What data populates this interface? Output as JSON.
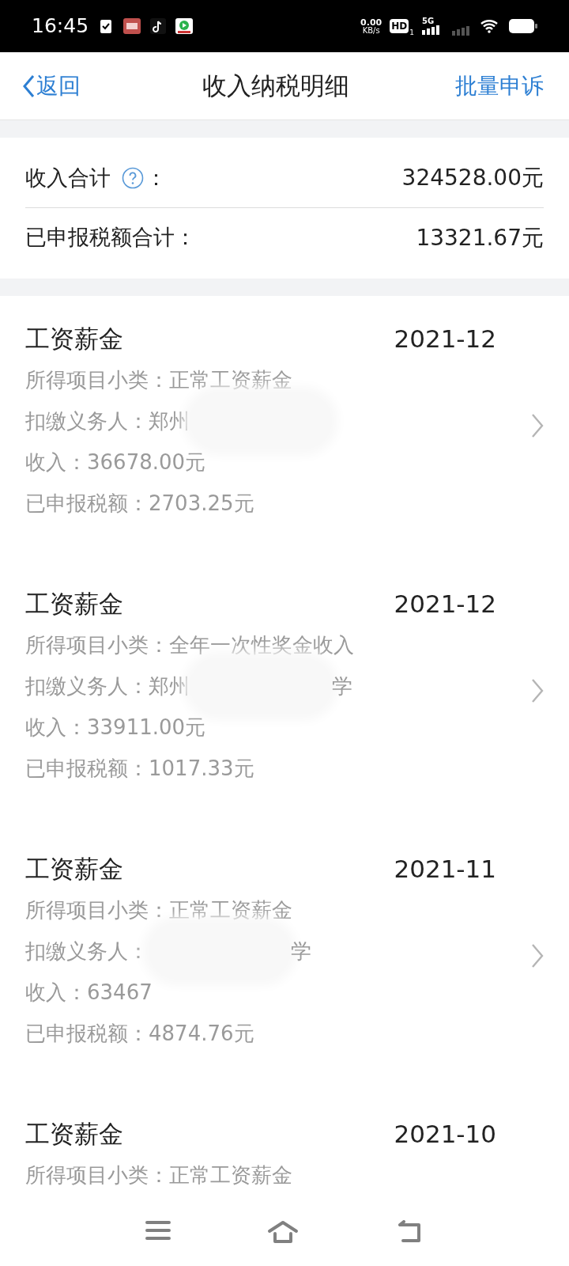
{
  "status_bar": {
    "time": "16:45",
    "net_speed": "0.00",
    "net_unit": "KB/s",
    "hd": "HD",
    "sim": "1",
    "network": "5G"
  },
  "nav": {
    "back": "返回",
    "title": "收入纳税明细",
    "action": "批量申诉"
  },
  "summary": [
    {
      "label": "收入合计",
      "help": true,
      "colon": "：",
      "value": "324528.00元"
    },
    {
      "label": "已申报税额合计：",
      "help": false,
      "value": "13321.67元"
    }
  ],
  "records": [
    {
      "title": "工资薪金",
      "date": "2021-12",
      "subtype": "所得项目小类：正常工资薪金",
      "payer_label": "扣缴义务人：",
      "payer_parts": [
        {
          "kind": "text",
          "text": "郑州"
        },
        {
          "kind": "redacted"
        }
      ],
      "income": "收入：36678.00元",
      "tax": "已申报税额：2703.25元"
    },
    {
      "title": "工资薪金",
      "date": "2021-12",
      "subtype": "所得项目小类：全年一次性奖金收入",
      "payer_label": "扣缴义务人：",
      "payer_parts": [
        {
          "kind": "text",
          "text": "郑州"
        },
        {
          "kind": "redacted"
        },
        {
          "kind": "text",
          "text": "学"
        }
      ],
      "income": "收入：33911.00元",
      "tax": "已申报税额：1017.33元"
    },
    {
      "title": "工资薪金",
      "date": "2021-11",
      "subtype": "所得项目小类：正常工资薪金",
      "payer_label": "扣缴义务人：",
      "payer_parts": [
        {
          "kind": "redacted"
        },
        {
          "kind": "text",
          "text": "学"
        }
      ],
      "income": "收入：63467",
      "tax": "已申报税额：4874.76元"
    },
    {
      "title": "工资薪金",
      "date": "2021-10",
      "subtype": "所得项目小类：正常工资薪金"
    }
  ]
}
